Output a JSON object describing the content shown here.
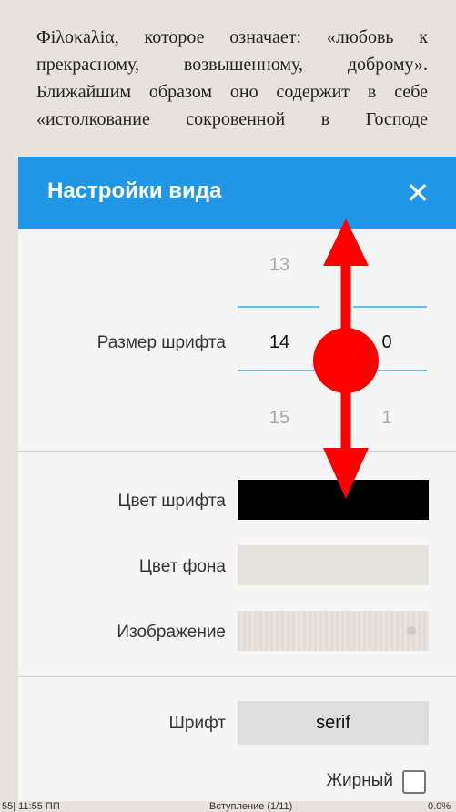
{
  "reader": {
    "lines": [
      "Фiλоκаλiα, которое означает: «любовь к",
      "прекрасному, возвышенному, доброму».",
      "Ближайшим образом оно содержит в себе",
      "«истолкование сокровенной в Господе"
    ]
  },
  "dialog": {
    "title": "Настройки вида",
    "close_icon": "close-icon",
    "font_size_label": "Размер шрифта",
    "font_size_picker": {
      "prev": "13",
      "current": "14",
      "next": "15"
    },
    "decimal_picker": {
      "current": "0",
      "next": "1"
    },
    "font_color_label": "Цвет шрифта",
    "font_color": "#000000",
    "bg_color_label": "Цвет фона",
    "bg_color": "#e6e2dc",
    "image_label": "Изображение",
    "font_label": "Шрифт",
    "font_value": "serif",
    "bold_label": "Жирный",
    "bold_checked": false
  },
  "statusbar": {
    "left": "55| 11:55 ПП",
    "center": "Вступление (1/11)",
    "right": "0.0%"
  },
  "overlay": {
    "gesture": "vertical-swipe",
    "color": "#ff0000"
  }
}
